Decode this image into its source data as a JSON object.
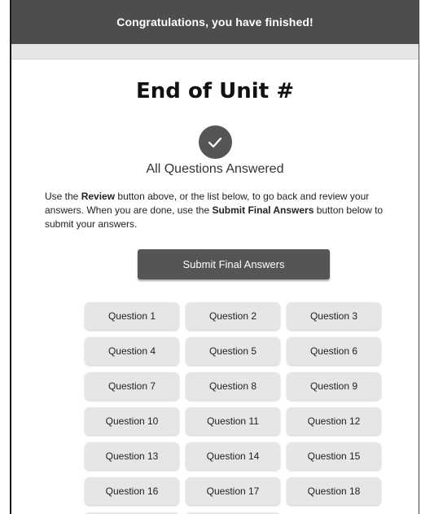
{
  "header": {
    "title": "Congratulations, you have finished!"
  },
  "main": {
    "heading": "End of Unit #",
    "status": {
      "icon": "checkmark-icon",
      "text": "All Questions Answered"
    },
    "instructions": {
      "part1": "Use the ",
      "review_bold": "Review",
      "part2": " button above, or the list below, to go back and review your answers. When you are done, use the ",
      "submit_bold": "Submit Final Answers",
      "part3": " button below to submit your answers."
    },
    "submit_label": "Submit Final Answers",
    "questions": [
      "Question 1",
      "Question 2",
      "Question 3",
      "Question 4",
      "Question 5",
      "Question 6",
      "Question 7",
      "Question 8",
      "Question 9",
      "Question 10",
      "Question 11",
      "Question 12",
      "Question 13",
      "Question 14",
      "Question 15",
      "Question 16",
      "Question 17",
      "Question 18"
    ]
  },
  "colors": {
    "header_bg": "#4d4d4d",
    "button_bg": "#555555",
    "question_bg": "#e6e6e6"
  }
}
